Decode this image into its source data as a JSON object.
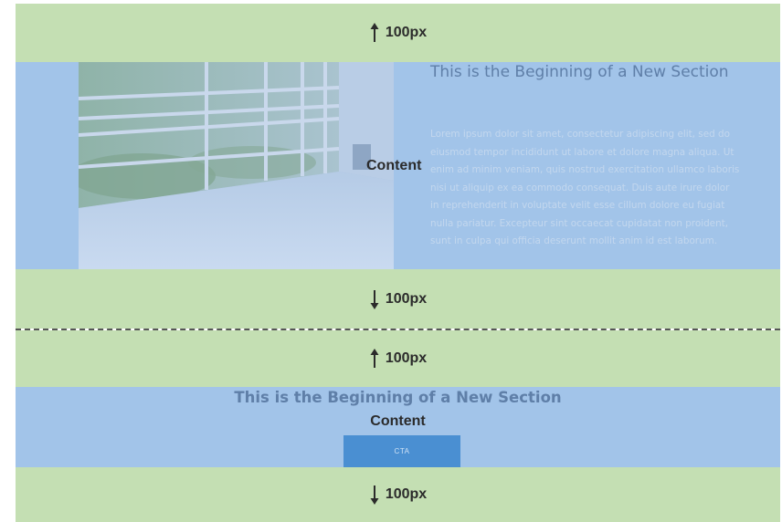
{
  "colors": {
    "padding_band": "#c4dfb3",
    "content_band": "#a2c4e9",
    "cta_button": "#4a8fd2",
    "divider": "#555555"
  },
  "section1": {
    "padding_top_label": "100px",
    "padding_bottom_label": "100px",
    "title": "This is the Beginning of a New Section",
    "body": "Lorem ipsum dolor sit amet, consectetur adipiscing elit, sed do eiusmod tempor incididunt ut labore et dolore magna aliqua. Ut enim ad minim veniam, quis nostrud exercitation ullamco laboris nisi ut aliquip ex ea commodo consequat. Duis aute irure dolor in reprehenderit in voluptate velit esse cillum dolore eu fugiat nulla pariatur. Excepteur sint occaecat cupidatat non proident, sunt in culpa qui officia deserunt mollit anim id est laborum.",
    "content_label": "Content",
    "arrow_top_icon": "arrow-up-icon",
    "arrow_bottom_icon": "arrow-down-icon"
  },
  "section2": {
    "padding_top_label": "100px",
    "padding_bottom_label": "100px",
    "title": "This is the Beginning of a New Section",
    "content_label": "Content",
    "cta_label": "CTA"
  }
}
